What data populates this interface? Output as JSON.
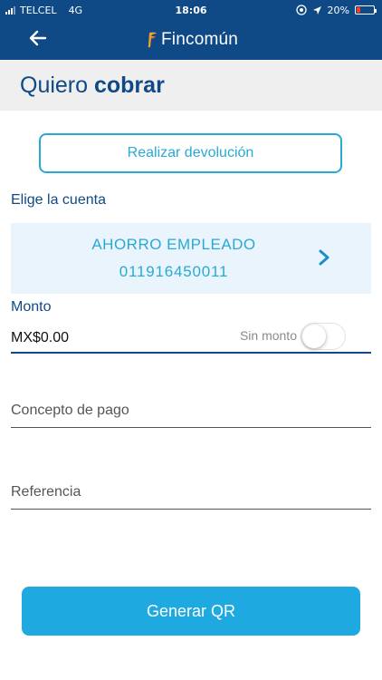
{
  "status_bar": {
    "carrier": "TELCEL",
    "network": "4G",
    "time": "18:06",
    "battery": "20%",
    "battery_level": 0.2
  },
  "nav": {
    "back_icon": "back-arrow-icon",
    "brand": "Fincomún"
  },
  "page": {
    "title_light": "Quiero ",
    "title_bold": "cobrar"
  },
  "refund_button": {
    "label": "Realizar devolución"
  },
  "account": {
    "section_label": "Elige la cuenta",
    "name": "AHORRO EMPLEADO",
    "number": "011916450011"
  },
  "amount": {
    "label": "Monto",
    "value": "MX$0.00",
    "no_amount_label": "Sin monto",
    "no_amount_on": false
  },
  "fields": {
    "concept_placeholder": "Concepto de pago",
    "reference_placeholder": "Referencia"
  },
  "qr_button": {
    "label": "Generar QR"
  },
  "colors": {
    "primary": "#0f4a86",
    "accent": "#29a9d6",
    "button": "#1ea9e0",
    "card_bg": "#eaf4fc"
  }
}
